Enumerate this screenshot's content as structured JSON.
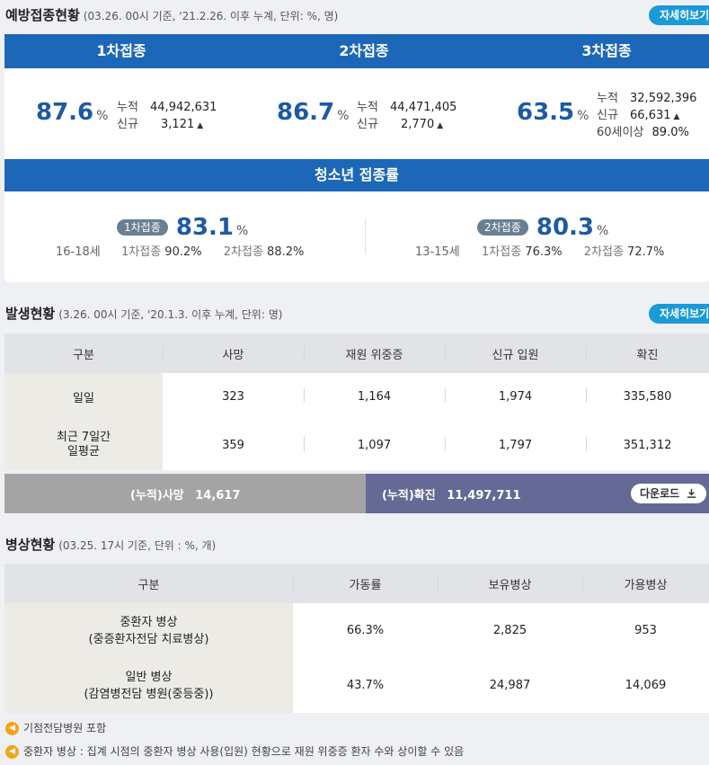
{
  "vaccination": {
    "title": "예방접종현황",
    "subtitle": "(03.26. 00시 기준, '21.2.26. 이후 누계, 단위: %, 명)",
    "more_button": "자세히보기",
    "doses": [
      {
        "header": "1차접종",
        "percent": "87.6",
        "unit": "%",
        "cumulative_label": "누적",
        "cumulative": "44,942,631",
        "new_label": "신규",
        "new": "3,121"
      },
      {
        "header": "2차접종",
        "percent": "86.7",
        "unit": "%",
        "cumulative_label": "누적",
        "cumulative": "44,471,405",
        "new_label": "신규",
        "new": "2,770"
      },
      {
        "header": "3차접종",
        "percent": "63.5",
        "unit": "%",
        "cumulative_label": "누적",
        "cumulative": "32,592,396",
        "new_label": "신규",
        "new": "66,631",
        "extra_label": "60세이상",
        "extra": "89.0%"
      }
    ],
    "youth": {
      "header": "청소년 접종률",
      "groups": [
        {
          "age": "16-18세",
          "pill": "1차접종",
          "percent": "83.1",
          "unit": "%",
          "first_label": "1차접종",
          "first": "90.2%",
          "second_label": "2차접종",
          "second": "88.2%"
        },
        {
          "age": "13-15세",
          "pill": "2차접종",
          "percent": "80.3",
          "unit": "%",
          "first_label": "1차접종",
          "first": "76.3%",
          "second_label": "2차접종",
          "second": "72.7%"
        }
      ]
    }
  },
  "occurrence": {
    "title": "발생현황",
    "subtitle": "(3.26. 00시 기준, '20.1.3. 이후 누계, 단위: 명)",
    "more_button": "자세히보기",
    "columns": [
      "구분",
      "사망",
      "재원 위중증",
      "신규 입원",
      "확진"
    ],
    "rows": [
      {
        "label": "일일",
        "values": [
          "323",
          "1,164",
          "1,974",
          "335,580"
        ]
      },
      {
        "label": "최근 7일간\n일평균",
        "values": [
          "359",
          "1,097",
          "1,797",
          "351,312"
        ]
      }
    ],
    "cumulative_death_label": "(누적)사망",
    "cumulative_death": "14,617",
    "cumulative_confirmed_label": "(누적)확진",
    "cumulative_confirmed": "11,497,711",
    "download_button": "다운로드"
  },
  "beds": {
    "title": "병상현황",
    "subtitle": "(03.25. 17시 기준, 단위 : %, 개)",
    "columns": [
      "구분",
      "가동률",
      "보유병상",
      "가용병상"
    ],
    "rows": [
      {
        "label": "중환자 병상\n(중증환자전담 치료병상)",
        "values": [
          "66.3%",
          "2,825",
          "953"
        ]
      },
      {
        "label": "일반 병상\n(감염병전담 병원(중등중))",
        "values": [
          "43.7%",
          "24,987",
          "14,069"
        ]
      }
    ],
    "notes": [
      "기점전담병원 포함",
      "중환자 병상 : 집계 시점의 중환자 병상 사용(입원) 현황으로 재원 위중증 환자 수와 상이할 수 있음"
    ]
  },
  "colors": {
    "primary": "#1d67b8",
    "accent": "#1a9ad6",
    "note_icon": "#f2a51a"
  },
  "icons": {
    "up": "triangle-up-icon",
    "download": "download-icon",
    "note": "speaker-icon"
  }
}
